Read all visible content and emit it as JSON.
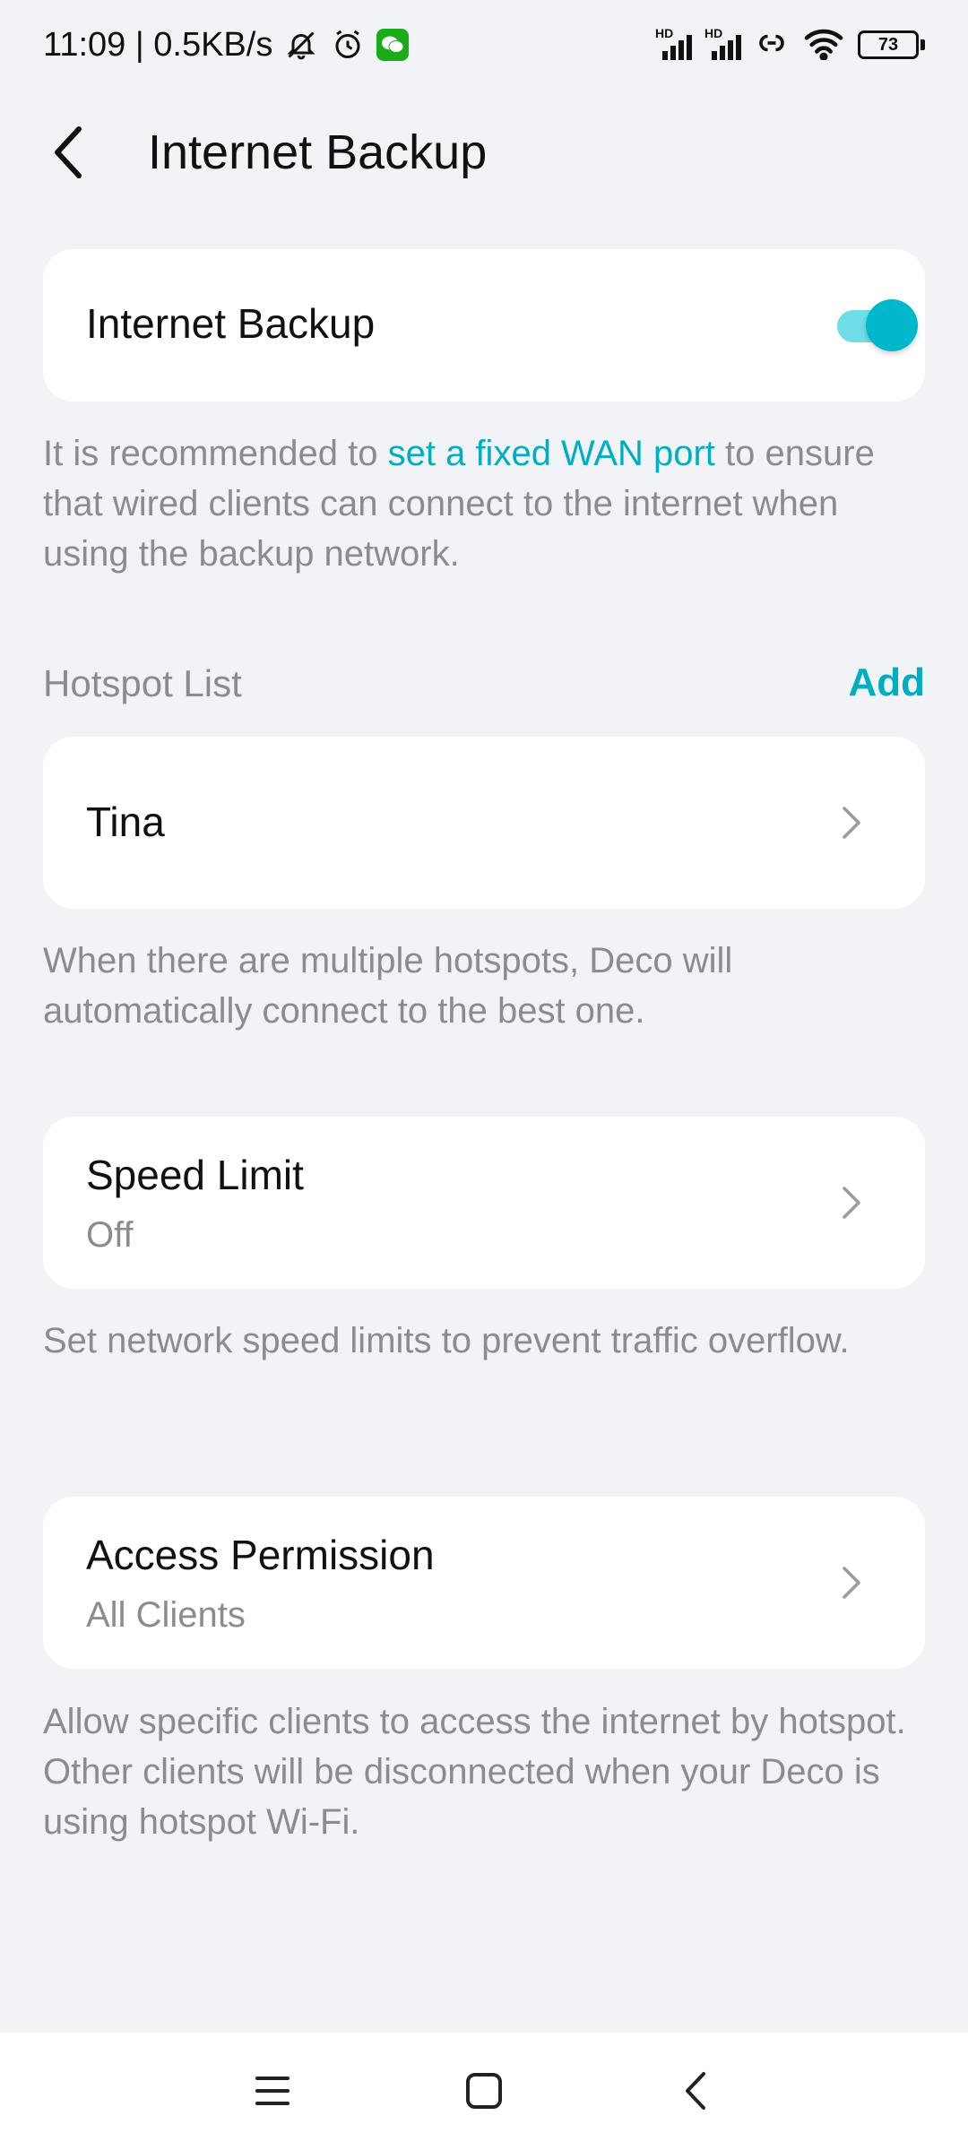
{
  "status_bar": {
    "time_speed": "11:09 | 0.5KB/s",
    "hd_label_1": "HD",
    "hd_label_2": "HD",
    "battery_level": "73",
    "icons": [
      "mute-bell-icon",
      "alarm-icon",
      "wechat-icon",
      "signal-icon",
      "signal-icon",
      "hotspot-link-icon",
      "wifi-icon",
      "battery-icon"
    ]
  },
  "header": {
    "title": "Internet Backup"
  },
  "backup_toggle": {
    "label": "Internet Backup",
    "enabled": true
  },
  "backup_help": {
    "prefix": "It is recommended to ",
    "link": "set a fixed WAN port",
    "suffix": " to ensure that wired clients can connect to the internet when using the backup network."
  },
  "hotspot_section": {
    "title": "Hotspot List",
    "add_label": "Add",
    "items": [
      {
        "label": "Tina"
      }
    ],
    "help": "When there are multiple hotspots, Deco will automatically connect to the best one."
  },
  "speed_limit": {
    "label": "Speed Limit",
    "value": "Off",
    "help": "Set network speed limits to prevent traffic overflow."
  },
  "access_permission": {
    "label": "Access Permission",
    "value": "All Clients",
    "help": "Allow specific clients to access the internet by hotspot. Other clients will be disconnected when your Deco is using hotspot Wi-Fi."
  },
  "colors": {
    "accent": "#00aec3",
    "background": "#f2f3f7",
    "card": "#ffffff",
    "muted_text": "#8a8c91"
  }
}
